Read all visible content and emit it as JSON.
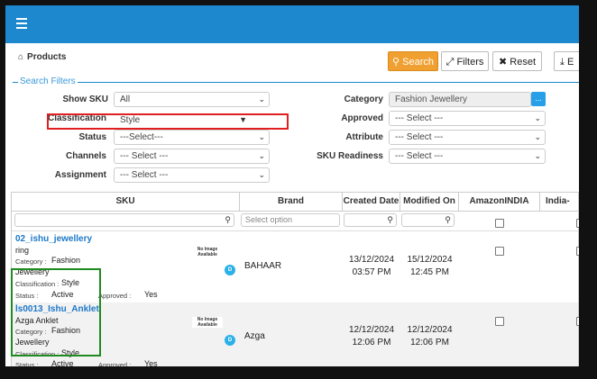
{
  "topbar": {
    "menu_icon": "hamburger-icon"
  },
  "breadcrumb": {
    "icon": "home-icon",
    "label": "Products"
  },
  "toolbar": {
    "search_label": "Search",
    "filters_label": "Filters",
    "reset_label": "Reset",
    "export_label": "E"
  },
  "search_filters": {
    "legend": "Search Filters",
    "show_sku": {
      "label": "Show SKU",
      "value": "All"
    },
    "classification": {
      "label": "Classification",
      "value": "Style"
    },
    "status": {
      "label": "Status",
      "value": "---Select---"
    },
    "channels": {
      "label": "Channels",
      "value": "--- Select ---"
    },
    "assignment": {
      "label": "Assignment",
      "value": "--- Select ---"
    },
    "category": {
      "label": "Category",
      "value": "Fashion Jewellery",
      "button": "..."
    },
    "approved": {
      "label": "Approved",
      "value": "--- Select ---"
    },
    "attribute": {
      "label": "Attribute",
      "value": "--- Select ---"
    },
    "sku_readiness": {
      "label": "SKU Readiness",
      "value": "--- Select ---"
    }
  },
  "table": {
    "columns": [
      "SKU",
      "Brand",
      "Created Date",
      "Modified On",
      "AmazonINDIA",
      "India-"
    ],
    "brand_filter_placeholder": "Select option",
    "no_image_text": "No Image Available",
    "badge": "D",
    "rows": [
      {
        "sku": "02_ishu_jewellery",
        "name": "ring",
        "category_label": "Category :",
        "category_value": "Fashion",
        "category_value2": "Jewellery",
        "classification_label": "Classification :",
        "classification_value": "Style",
        "status_label": "Status :",
        "status_value": "Active",
        "approved_label": "Approved :",
        "approved_value": "Yes",
        "brand": "BAHAAR",
        "created_date": "13/12/2024",
        "created_time": "03:57 PM",
        "modified_date": "15/12/2024",
        "modified_time": "12:45 PM"
      },
      {
        "sku": "ls0013_Ishu_Anklet",
        "name": "Azga Anklet",
        "category_label": "Category :",
        "category_value": "Fashion",
        "category_value2": "Jewellery",
        "classification_label": "Classification :",
        "classification_value": "Style",
        "status_label": "Status :",
        "status_value": "Active",
        "approved_label": "Approved :",
        "approved_value": "Yes",
        "brand": "Azga",
        "created_date": "12/12/2024",
        "created_time": "12:06 PM",
        "modified_date": "12/12/2024",
        "modified_time": "12:06 PM"
      }
    ]
  },
  "colors": {
    "topbar": "#1e88cf",
    "search_button": "#f0a030",
    "highlight_red": "#e02020",
    "highlight_green": "#1f8a1f",
    "link": "#1e78c8"
  }
}
